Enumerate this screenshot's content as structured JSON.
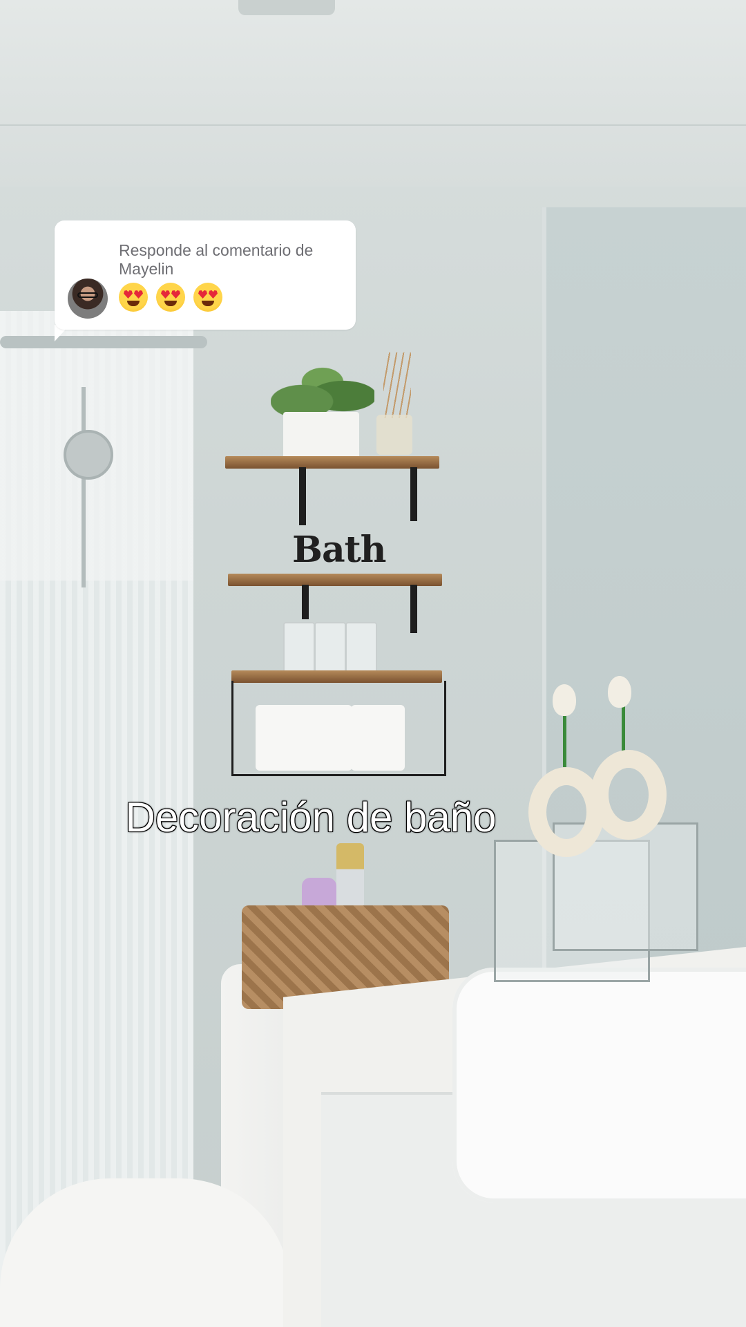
{
  "reply_card": {
    "title": "Responde al comentario de Mayelin",
    "emojis": [
      "heart-eyes-emoji",
      "heart-eyes-emoji",
      "heart-eyes-emoji"
    ]
  },
  "caption": {
    "text": "Decoración de baño"
  },
  "scene": {
    "sign_text": "Bath"
  },
  "colors": {
    "card_background": "#ffffff",
    "card_text": "#6e6e73",
    "caption_fill": "#ffffff",
    "caption_outline": "#000000"
  }
}
